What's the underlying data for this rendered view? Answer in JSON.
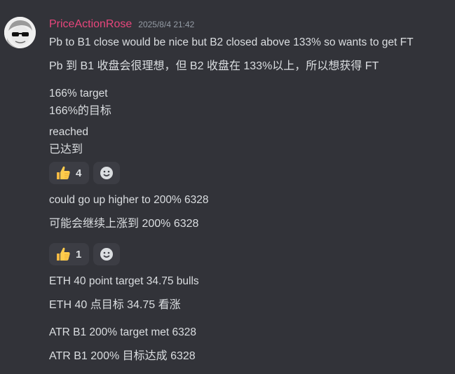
{
  "message": {
    "username": "PriceActionRose",
    "timestamp": "2025/8/4 21:42",
    "lines": [
      "Pb to B1 close would be nice but B2 closed above 133% so wants to get FT",
      "Pb 到 B1 收盘会很理想，但 B2 收盘在 133%以上，所以想获得 FT",
      "166% target",
      "166%的目标",
      "reached",
      "已达到",
      "could go up higher to 200% 6328",
      "可能会继续上涨到 200% 6328",
      "ETH 40 point target 34.75 bulls",
      "ETH 40 点目标 34.75 看涨",
      "ATR B1 200% target met 6328",
      "ATR B1 200% 目标达成 6328"
    ]
  },
  "reactions": [
    {
      "emoji": "thumbs-up-icon",
      "count": "4"
    },
    {
      "emoji": "thumbs-up-icon",
      "count": "1"
    }
  ],
  "colors": {
    "background": "#323339",
    "username": "#e8467c",
    "text": "#dbdee1",
    "timestamp": "#949ba4",
    "reaction_bg": "#3c3d44"
  }
}
